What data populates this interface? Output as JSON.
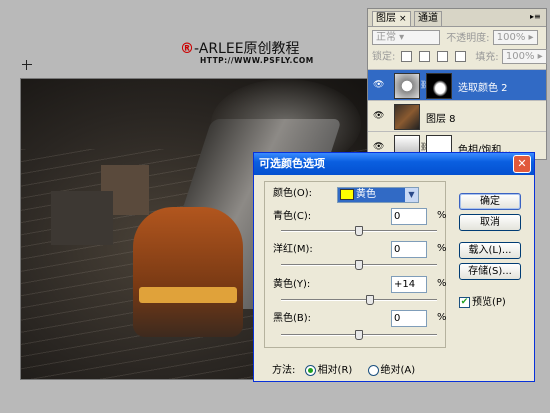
{
  "header": {
    "brand_mark": "®",
    "brand_text": "-ARLEE原创教程",
    "url": "HTTP://WWW.PSFLY.COM"
  },
  "layers_panel": {
    "tabs": [
      {
        "label": "图层"
      },
      {
        "label": "通道"
      }
    ],
    "blend_mode": "正常",
    "opacity_label": "不透明度:",
    "opacity_value": "100%",
    "lock_label": "锁定:",
    "fill_label": "填充:",
    "fill_value": "100%",
    "layers": [
      {
        "name": "选取颜色 2",
        "selected": true,
        "visible": true
      },
      {
        "name": "图层 8",
        "selected": false,
        "visible": true
      },
      {
        "name": "色相/饱和...",
        "selected": false,
        "visible": true
      }
    ]
  },
  "dialog": {
    "title": "可选颜色选项",
    "color_label": "颜色(O):",
    "color_value": "黄色",
    "swatch_color": "#ffff00",
    "sliders": [
      {
        "label": "青色(C):",
        "value": "0",
        "unit": "%",
        "fraction": 0.5
      },
      {
        "label": "洋红(M):",
        "value": "0",
        "unit": "%",
        "fraction": 0.5
      },
      {
        "label": "黄色(Y):",
        "value": "+14",
        "unit": "%",
        "fraction": 0.57
      },
      {
        "label": "黑色(B):",
        "value": "0",
        "unit": "%",
        "fraction": 0.5
      }
    ],
    "buttons": {
      "ok": "确定",
      "cancel": "取消",
      "load": "载入(L)...",
      "save": "存储(S)..."
    },
    "preview_label": "预览(P)",
    "preview_checked": true,
    "method_label": "方法:",
    "method_relative": "相对(R)",
    "method_absolute": "绝对(A)",
    "method_selected": "relative"
  },
  "colors": {
    "accent": "#316ac5",
    "title_bar": "#0a5fe0",
    "close": "#e15a3c"
  }
}
